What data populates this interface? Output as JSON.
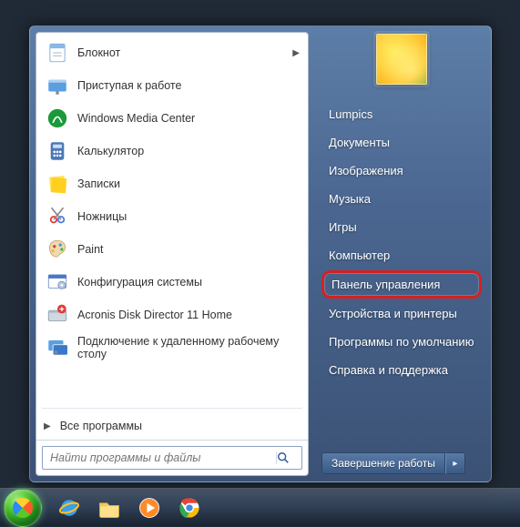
{
  "programs": [
    {
      "label": "Блокнот",
      "icon": "notepad",
      "hasSubmenu": true
    },
    {
      "label": "Приступая к работе",
      "icon": "getting-started"
    },
    {
      "label": "Windows Media Center",
      "icon": "wmc"
    },
    {
      "label": "Калькулятор",
      "icon": "calculator"
    },
    {
      "label": "Записки",
      "icon": "sticky-notes"
    },
    {
      "label": "Ножницы",
      "icon": "snipping-tool"
    },
    {
      "label": "Paint",
      "icon": "paint"
    },
    {
      "label": "Конфигурация системы",
      "icon": "msconfig"
    },
    {
      "label": "Acronis Disk Director 11 Home",
      "icon": "acronis"
    },
    {
      "label": "Подключение к удаленному рабочему столу",
      "icon": "rdp"
    }
  ],
  "allPrograms": "Все программы",
  "search": {
    "placeholder": "Найти программы и файлы"
  },
  "rightItems": [
    {
      "label": "Lumpics"
    },
    {
      "label": "Документы"
    },
    {
      "label": "Изображения"
    },
    {
      "label": "Музыка"
    },
    {
      "label": "Игры"
    },
    {
      "label": "Компьютер"
    },
    {
      "label": "Панель управления",
      "highlight": true
    },
    {
      "label": "Устройства и принтеры"
    },
    {
      "label": "Программы по умолчанию"
    },
    {
      "label": "Справка и поддержка"
    }
  ],
  "shutdown": {
    "label": "Завершение работы"
  },
  "taskbar": [
    {
      "name": "ie-icon"
    },
    {
      "name": "explorer-icon"
    },
    {
      "name": "wmp-icon"
    },
    {
      "name": "chrome-icon"
    }
  ]
}
